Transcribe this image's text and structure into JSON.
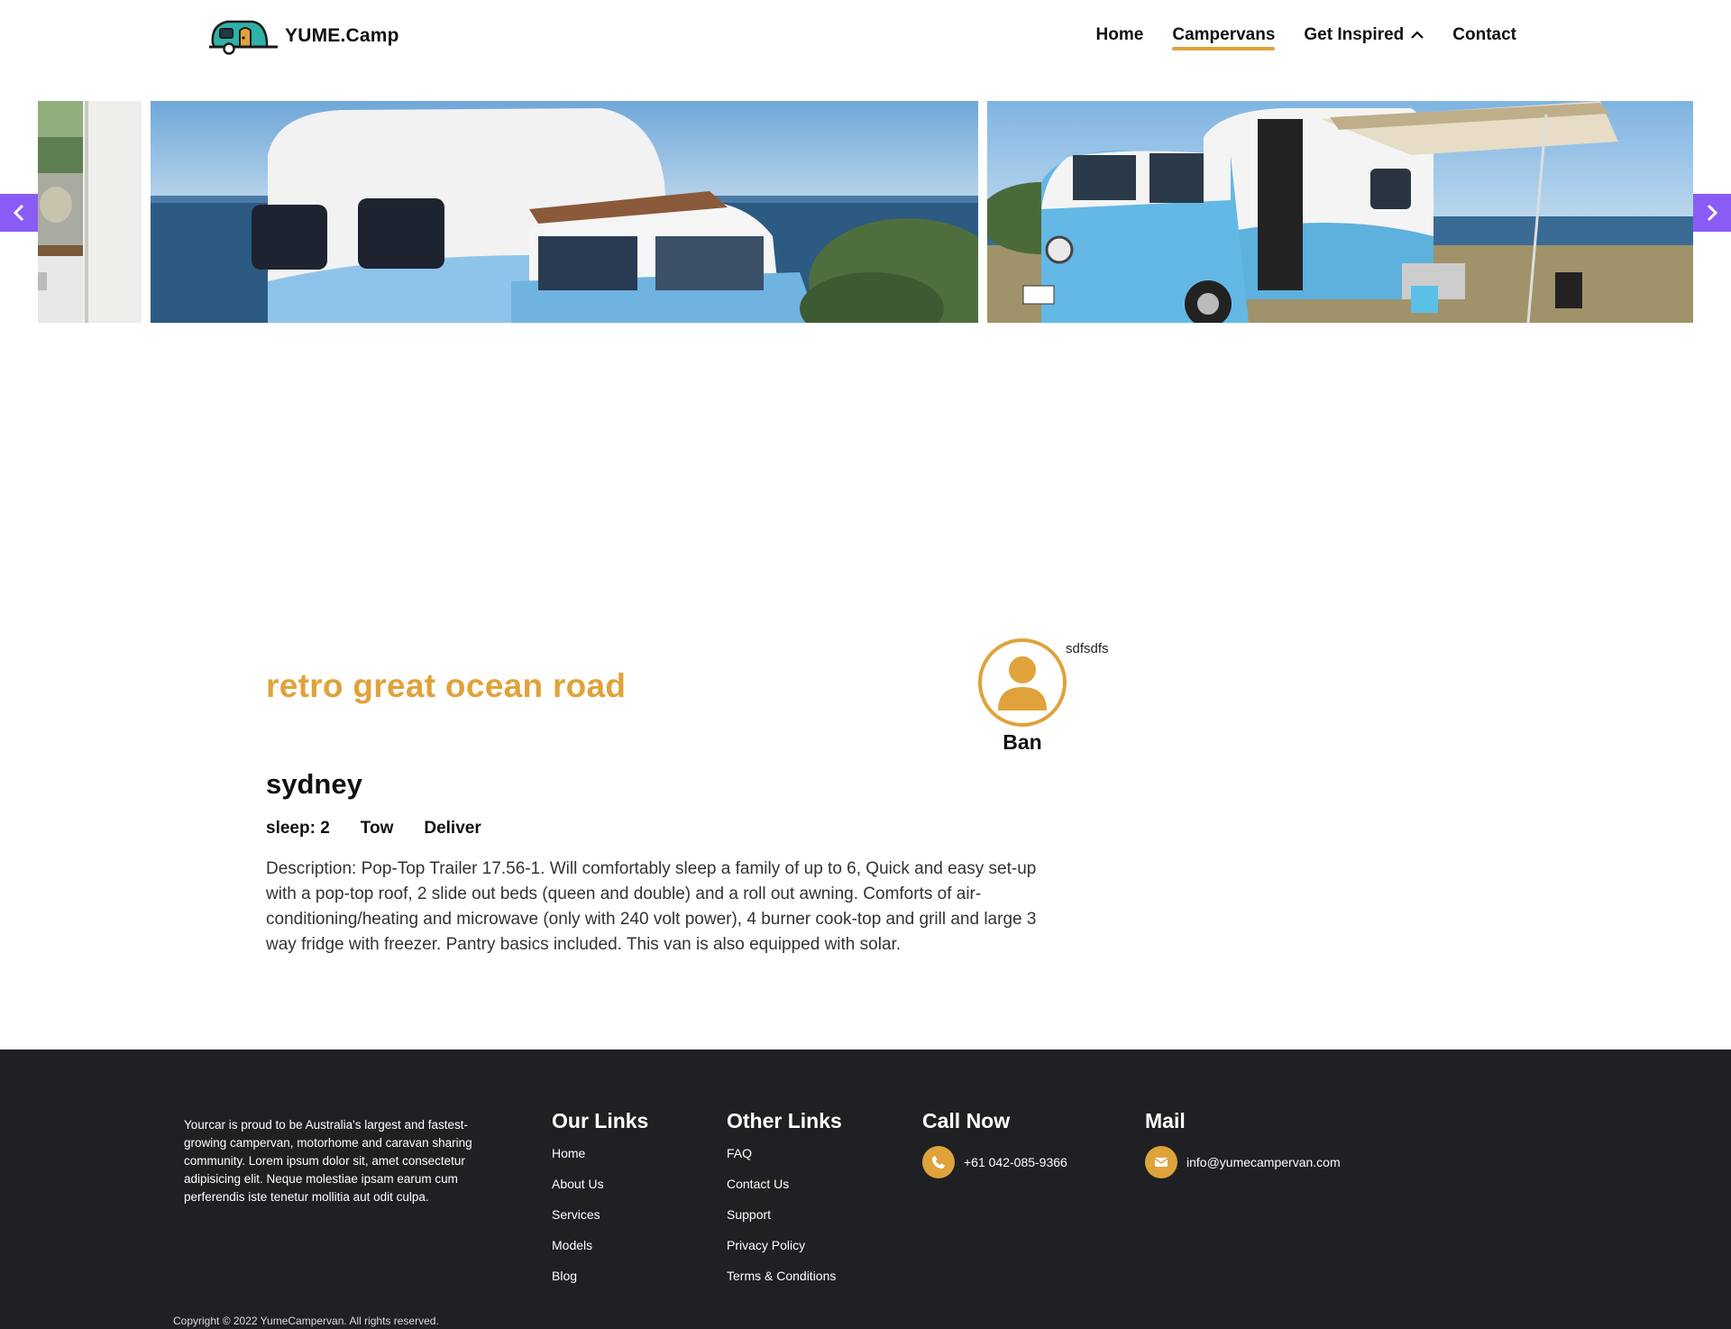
{
  "brand": {
    "name": "YUME.Camp",
    "logo_icon": "caravan-icon"
  },
  "nav": {
    "items": [
      {
        "label": "Home",
        "active": false
      },
      {
        "label": "Campervans",
        "active": true
      },
      {
        "label": "Get Inspired",
        "active": false,
        "has_dropdown": true
      },
      {
        "label": "Contact",
        "active": false
      }
    ]
  },
  "carousel": {
    "prev_icon": "chevron-left-icon",
    "next_icon": "chevron-right-icon",
    "accent": "#8a5cf6"
  },
  "listing": {
    "title": "retro great ocean road",
    "city": "sydney",
    "features": [
      "sleep: 2",
      "Tow",
      "Deliver"
    ],
    "description": "Description: Pop-Top Trailer 17.56-1. Will comfortably sleep a family of up to 6, Quick and easy set-up with a pop-top roof, 2 slide out beds (queen and double) and a roll out awning. Comforts of air-conditioning/heating and microwave (only with 240 volt power), 4 burner cook-top and grill and large 3 way fridge with freezer. Pantry basics included. This van is also equipped with solar.",
    "host": {
      "name": "Ban",
      "note": "sdfsdfs",
      "avatar_icon": "user-icon"
    }
  },
  "footer": {
    "about": "Yourcar is proud to be Australia's largest and fastest-growing campervan, motorhome and caravan sharing community. Lorem ipsum dolor sit, amet consectetur adipisicing elit. Neque molestiae ipsam earum cum perferendis iste tenetur mollitia aut odit culpa.",
    "our_links": {
      "heading": "Our Links",
      "items": [
        "Home",
        "About Us",
        "Services",
        "Models",
        "Blog"
      ]
    },
    "other_links": {
      "heading": "Other Links",
      "items": [
        "FAQ",
        "Contact Us",
        "Support",
        "Privacy Policy",
        "Terms & Conditions"
      ]
    },
    "call": {
      "heading": "Call Now",
      "phone": "+61 042-085-9366",
      "icon": "phone-icon"
    },
    "mail": {
      "heading": "Mail",
      "email": "info@yumecampervan.com",
      "icon": "envelope-icon"
    },
    "copyright": "Copyright © 2022 YumeCampervan. All rights reserved."
  },
  "colors": {
    "accent": "#e0a23a",
    "footer_bg": "#1e2023",
    "carousel_arrow": "#8a5cf6"
  }
}
